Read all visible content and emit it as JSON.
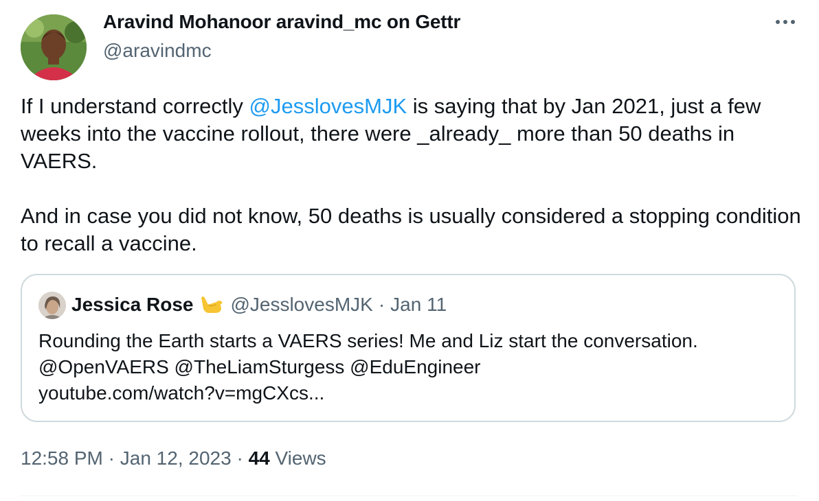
{
  "tweet": {
    "author_name": "Aravind Mohanoor aravind_mc on Gettr",
    "author_handle": "@aravindmc",
    "para1_before": "If I understand correctly ",
    "para1_mention": "@JesslovesMJK",
    "para1_after": " is saying that by Jan 2021, just a few weeks into the vaccine rollout, there were _already_ more than 50 deaths in VAERS.",
    "para2": "And in case you did not know, 50 deaths is usually considered a stopping condition to recall a vaccine.",
    "time": "12:58 PM",
    "date": "Jan 12, 2023",
    "views_count": "44",
    "views_label": "Views",
    "separator": "·"
  },
  "quote": {
    "author_name": "Jessica Rose",
    "emoji": "call-me-hand-emoji",
    "author_handle": "@JesslovesMJK",
    "separator": "·",
    "date": "Jan 11",
    "line1": "Rounding the Earth starts a VAERS series! Me and Liz start the conversation.",
    "line2": "@OpenVAERS @TheLiamSturgess @EduEngineer",
    "line3": "youtube.com/watch?v=mgCXcs..."
  },
  "icons": {
    "more": "more-horizontal-icon"
  },
  "colors": {
    "text": "#0f1419",
    "secondary": "#536471",
    "link": "#1d9bf0",
    "border": "#cfd9de"
  }
}
